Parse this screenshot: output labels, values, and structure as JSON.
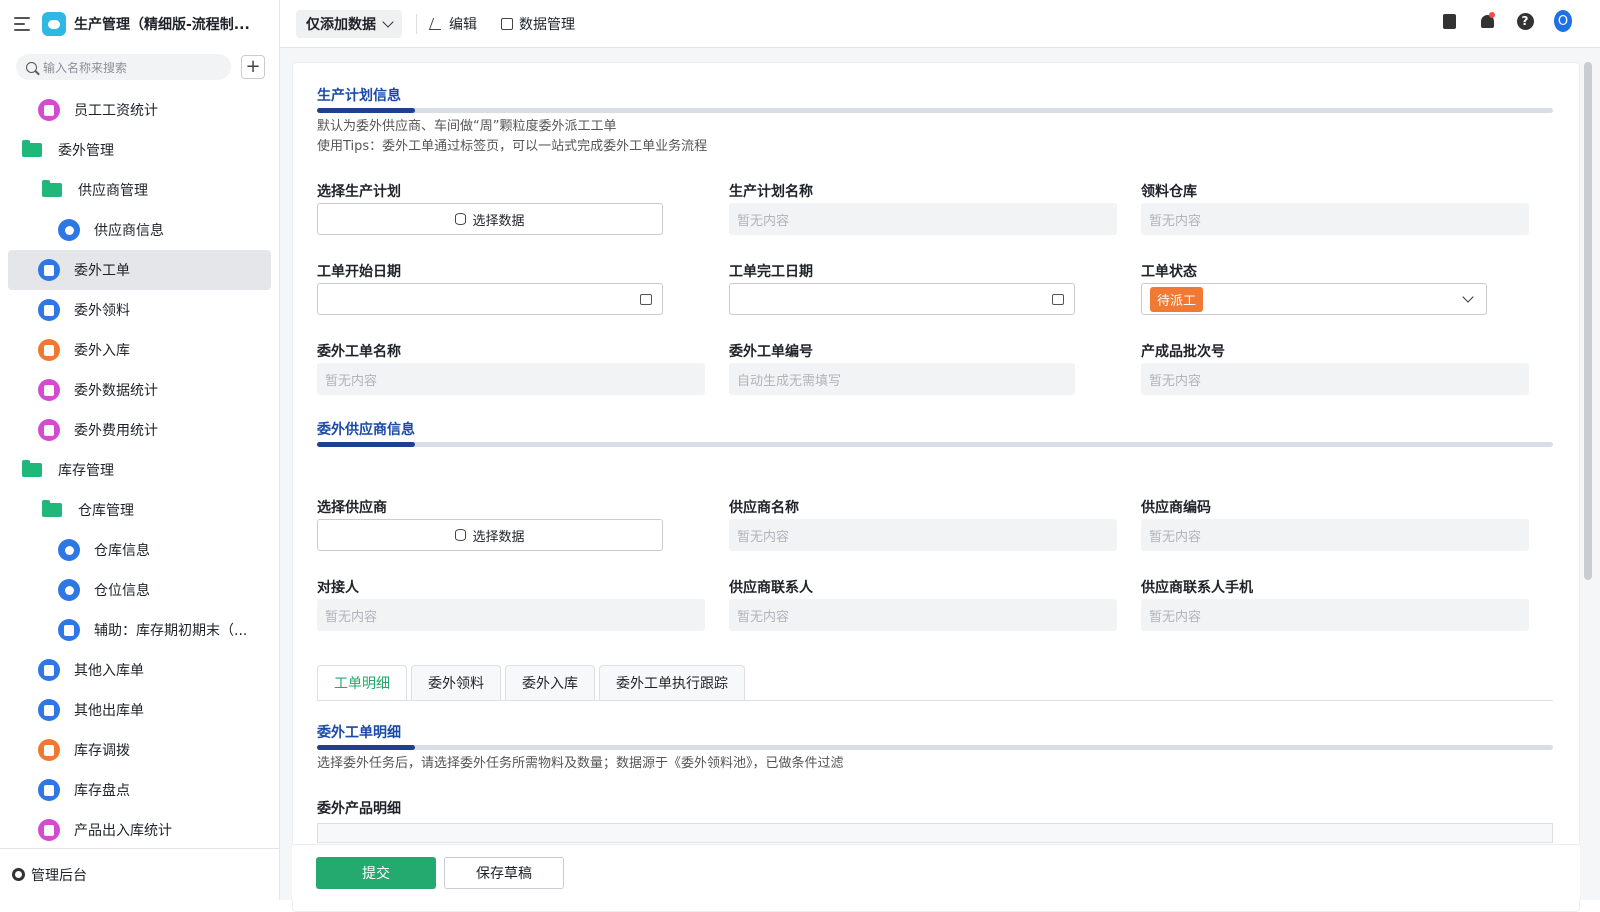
{
  "app": {
    "title": "生产管理（精细版-流程制..."
  },
  "sidebar": {
    "search_placeholder": "输入名称来搜索",
    "add_label": "+",
    "items": [
      {
        "label": "员工工资统计",
        "icon": "chart-icon"
      },
      {
        "label": "委外管理",
        "icon": "folder-icon"
      },
      {
        "label": "供应商管理",
        "icon": "folder-icon"
      },
      {
        "label": "供应商信息",
        "icon": "user-icon"
      },
      {
        "label": "委外工单",
        "icon": "document-icon"
      },
      {
        "label": "委外领料",
        "icon": "document-icon"
      },
      {
        "label": "委外入库",
        "icon": "warehouse-in-icon"
      },
      {
        "label": "委外数据统计",
        "icon": "chart-icon"
      },
      {
        "label": "委外费用统计",
        "icon": "chart-icon"
      },
      {
        "label": "库存管理",
        "icon": "folder-icon"
      },
      {
        "label": "仓库管理",
        "icon": "folder-icon"
      },
      {
        "label": "仓库信息",
        "icon": "home-icon"
      },
      {
        "label": "仓位信息",
        "icon": "home-icon"
      },
      {
        "label": "辅助：库存期初期末（...",
        "icon": "document-icon"
      },
      {
        "label": "其他入库单",
        "icon": "document-icon"
      },
      {
        "label": "其他出库单",
        "icon": "document-icon"
      },
      {
        "label": "库存调拨",
        "icon": "warehouse-in-icon"
      },
      {
        "label": "库存盘点",
        "icon": "document-icon"
      },
      {
        "label": "产品出入库统计",
        "icon": "chart-icon"
      }
    ],
    "footer_label": "管理后台"
  },
  "toolbar": {
    "mode_label": "仅添加数据",
    "edit_label": "编辑",
    "data_manage_label": "数据管理",
    "avatar_letter": "O"
  },
  "form": {
    "section1": {
      "title": "生产计划信息",
      "desc1": "默认为委外供应商、车间做“周”颗粒度委外派工工单",
      "desc2": "使用Tips：委外工单通过标签页，可以一站式完成委外工单业务流程"
    },
    "fields": {
      "plan_select_label": "选择生产计划",
      "plan_select_btn": "选择数据",
      "plan_name_label": "生产计划名称",
      "plan_name_value": "暂无内容",
      "warehouse_label": "领料仓库",
      "warehouse_value": "暂无内容",
      "start_date_label": "工单开始日期",
      "end_date_label": "工单完工日期",
      "status_label": "工单状态",
      "status_value": "待派工",
      "order_name_label": "委外工单名称",
      "order_name_value": "暂无内容",
      "order_no_label": "委外工单编号",
      "order_no_value": "自动生成无需填写",
      "batch_label": "产成品批次号",
      "batch_value": "暂无内容"
    },
    "section2": {
      "title": "委外供应商信息"
    },
    "supplier": {
      "select_label": "选择供应商",
      "select_btn": "选择数据",
      "name_label": "供应商名称",
      "name_value": "暂无内容",
      "code_label": "供应商编码",
      "code_value": "暂无内容",
      "contact_label": "对接人",
      "contact_value": "暂无内容",
      "sup_contact_label": "供应商联系人",
      "sup_contact_value": "暂无内容",
      "phone_label": "供应商联系人手机",
      "phone_value": "暂无内容"
    },
    "tabs": [
      "工单明细",
      "委外领料",
      "委外入库",
      "委外工单执行跟踪"
    ],
    "section3": {
      "title": "委外工单明细",
      "desc": "选择委外任务后，请选择委外任务所需物料及数量；数据源于《委外领料池》，已做条件过滤",
      "sub_label": "委外产品明细"
    },
    "submit_label": "提交",
    "draft_label": "保存草稿"
  },
  "colors": {
    "accent": "#24a96e",
    "section_title": "#1a4aa8",
    "status_tag": "#f07a33"
  }
}
